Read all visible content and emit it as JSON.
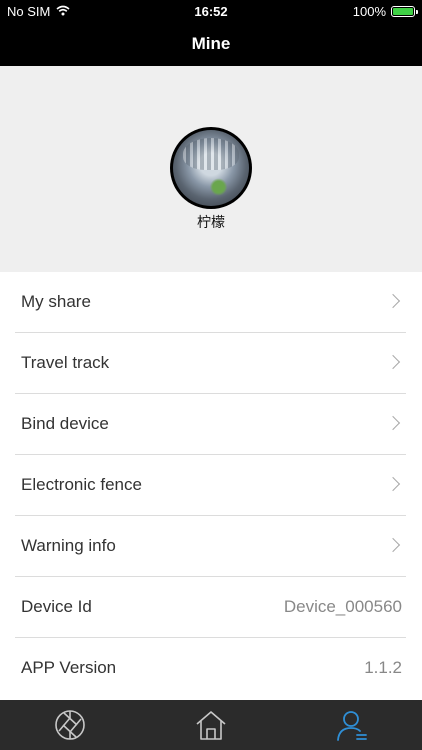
{
  "status": {
    "carrier": "No SIM",
    "time": "16:52",
    "battery": "100%"
  },
  "nav": {
    "title": "Mine"
  },
  "profile": {
    "name": "柠檬"
  },
  "menu": {
    "items": [
      {
        "label": "My share"
      },
      {
        "label": "Travel track"
      },
      {
        "label": "Bind device"
      },
      {
        "label": "Electronic fence"
      },
      {
        "label": "Warning info"
      }
    ],
    "device_id_label": "Device Id",
    "device_id_value": "Device_000560",
    "app_version_label": "APP Version",
    "app_version_value": "1.1.2"
  },
  "tabs": {
    "icons": [
      "camera-shutter-icon",
      "home-icon",
      "user-profile-icon"
    ],
    "active_color": "#2f8fd6",
    "inactive_color": "#c8c8c8"
  }
}
